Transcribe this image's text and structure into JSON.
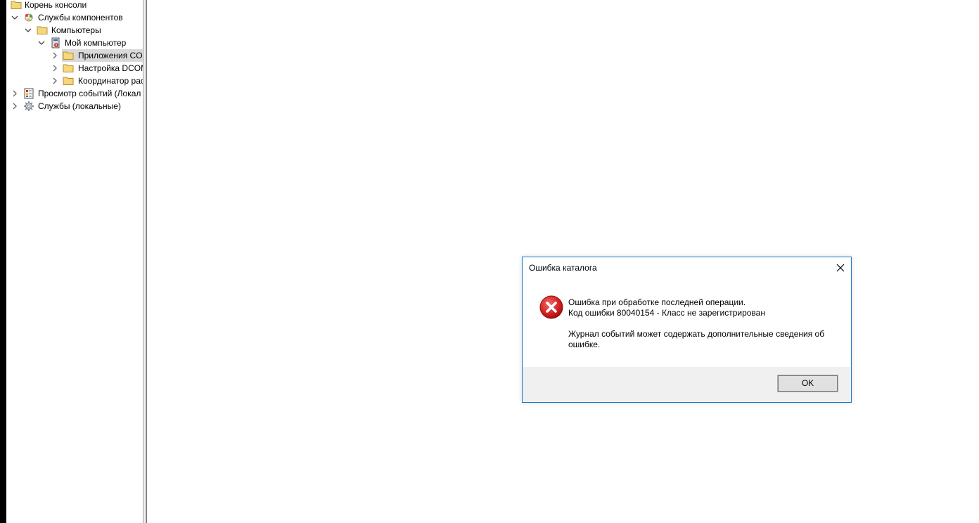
{
  "tree": {
    "items": [
      {
        "label": "Корень консоли",
        "icon": "folder-icon"
      },
      {
        "label": "Службы компонентов",
        "icon": "component-services-icon"
      },
      {
        "label": "Компьютеры",
        "icon": "folder-icon"
      },
      {
        "label": "Мой компьютер",
        "icon": "my-computer-icon"
      },
      {
        "label": "Приложения CO",
        "icon": "folder-icon"
      },
      {
        "label": "Настройка DCOM",
        "icon": "folder-icon"
      },
      {
        "label": "Координатор рас",
        "icon": "folder-icon"
      },
      {
        "label": "Просмотр событий (Локал",
        "icon": "event-viewer-icon"
      },
      {
        "label": "Службы (локальные)",
        "icon": "services-gear-icon"
      }
    ]
  },
  "dialog": {
    "title": "Ошибка каталога",
    "line1": "Ошибка при обработке последней операции.",
    "line2": "Код ошибки 80040154 - Класс не зарегистрирован",
    "line3": "Журнал событий может содержать дополнительные сведения об",
    "line4": "ошибке.",
    "ok_label": "OK",
    "icon": "error-icon",
    "accent_color": "#1979ca",
    "error_color": "#d42020"
  }
}
